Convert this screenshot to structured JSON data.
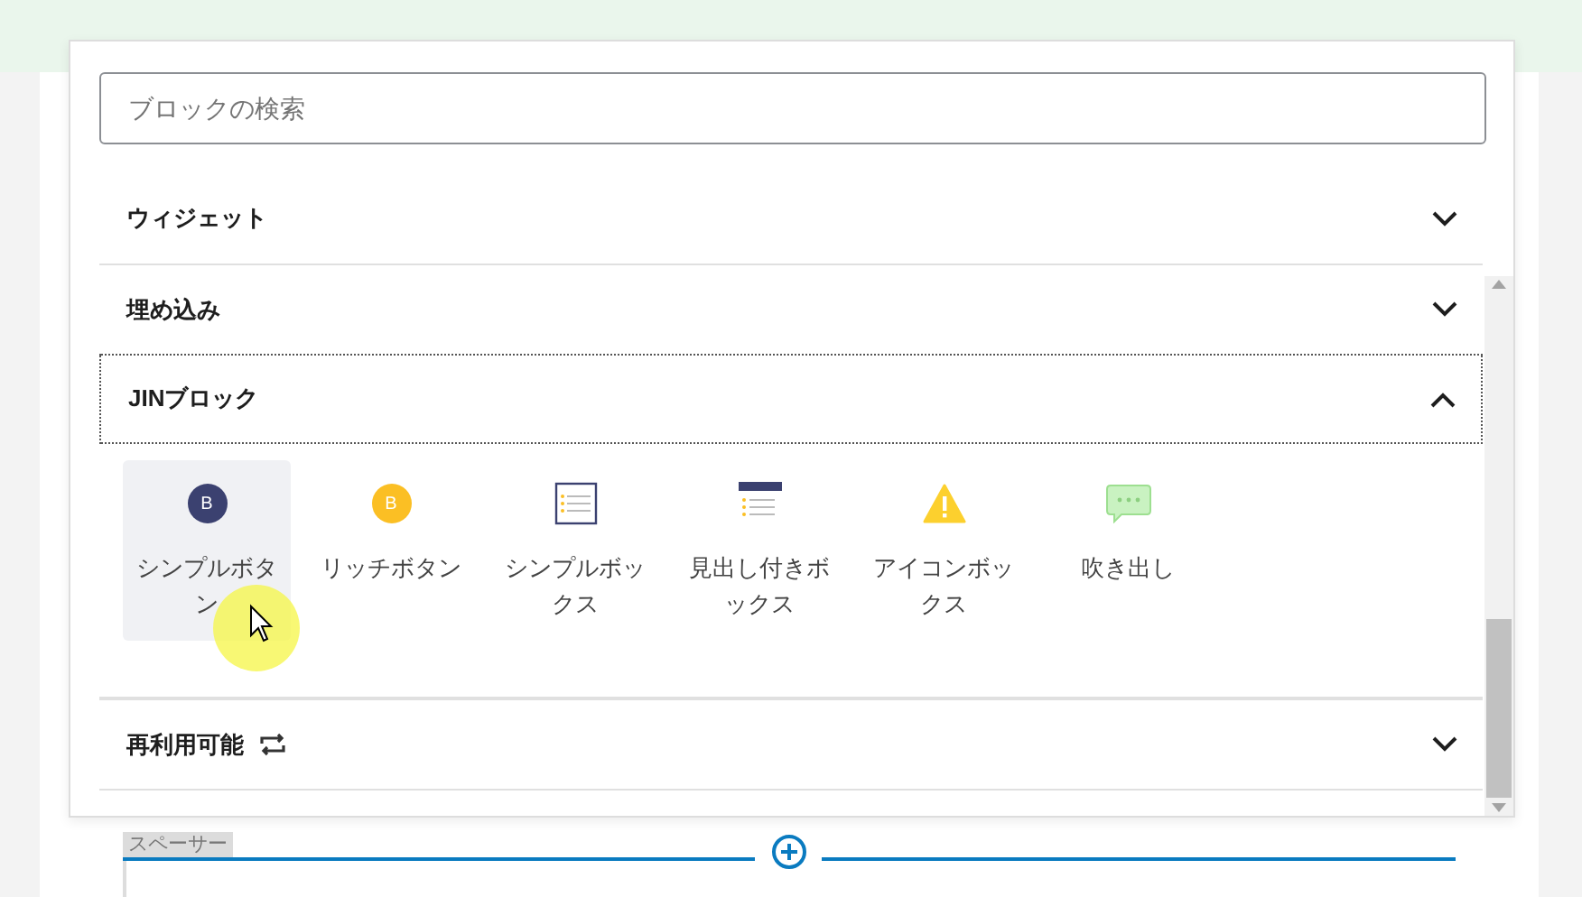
{
  "search": {
    "placeholder": "ブロックの検索"
  },
  "sections": [
    {
      "title": "ウィジェット",
      "expanded": false,
      "focused": false
    },
    {
      "title": "埋め込み",
      "expanded": false,
      "focused": false
    },
    {
      "title": "JINブロック",
      "expanded": true,
      "focused": true,
      "items": [
        {
          "label": "シンプルボタン",
          "kind": "simple-button",
          "icon_text": "B",
          "selected": true
        },
        {
          "label": "リッチボタン",
          "kind": "rich-button",
          "icon_text": "B",
          "selected": false
        },
        {
          "label": "シンプルボックス",
          "kind": "simple-box",
          "selected": false
        },
        {
          "label": "見出し付きボックス",
          "kind": "heading-box",
          "selected": false
        },
        {
          "label": "アイコンボックス",
          "kind": "icon-box",
          "selected": false
        },
        {
          "label": "吹き出し",
          "kind": "speech",
          "selected": false
        }
      ]
    },
    {
      "title": "再利用可能",
      "expanded": false,
      "focused": false,
      "reusable": true
    }
  ],
  "spacer": {
    "label": "スペーサー"
  }
}
